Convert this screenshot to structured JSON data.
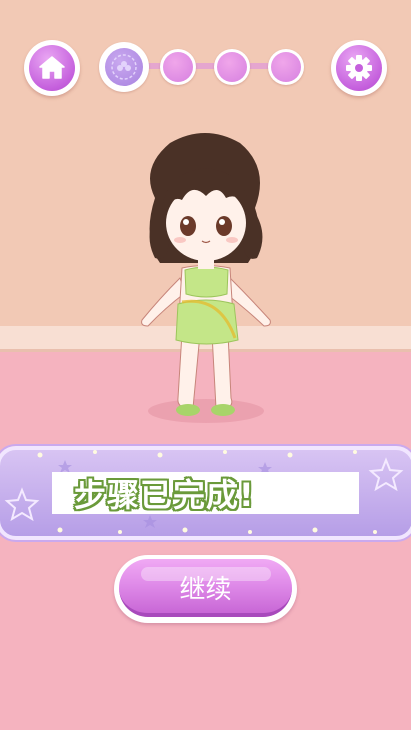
{
  "header": {
    "home_icon": "home-icon",
    "settings_icon": "gear-icon"
  },
  "progress": {
    "total_steps": 4,
    "current_step": 1
  },
  "banner": {
    "message": "步骤已完成!"
  },
  "continue_button": {
    "label": "继续"
  },
  "colors": {
    "wall": "#f2c9b5",
    "floor": "#f5b3bf",
    "accent_purple": "#c560dd",
    "banner": "#c4acec",
    "text_outline": "#6a9a3a"
  }
}
